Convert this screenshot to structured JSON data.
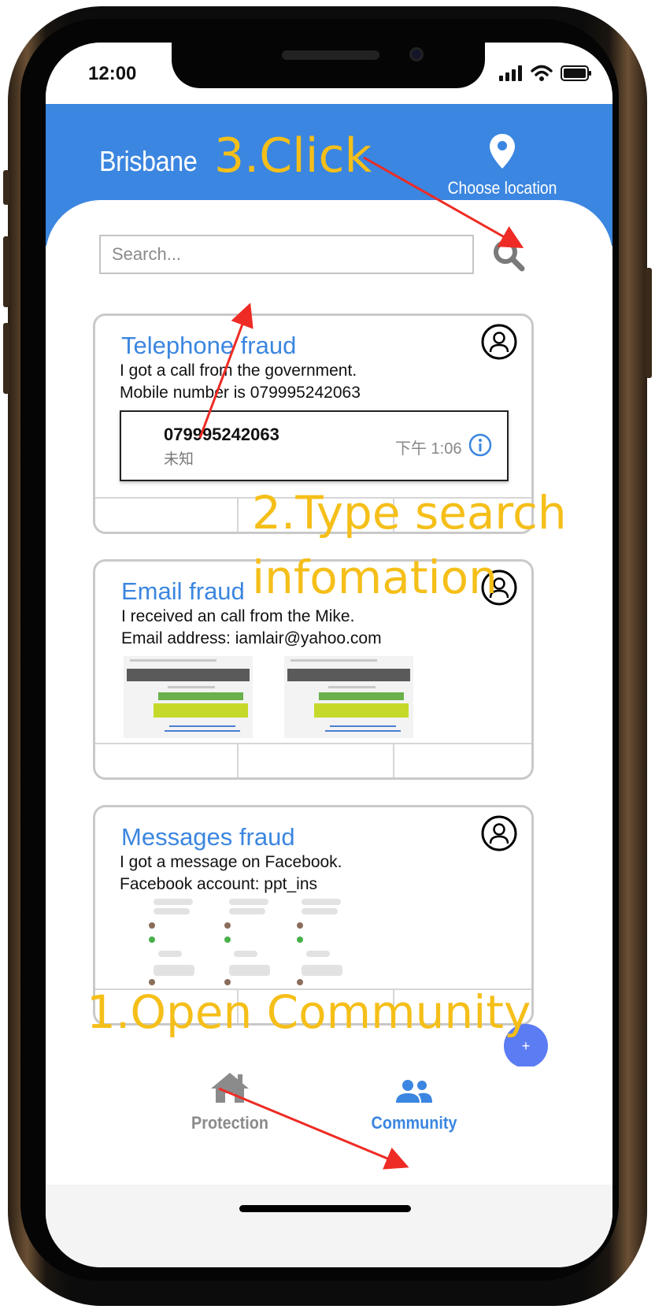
{
  "status_bar": {
    "time": "12:00"
  },
  "header": {
    "city": "Brisbane",
    "location_label": "Choose location"
  },
  "search": {
    "placeholder": "Search..."
  },
  "cards": [
    {
      "title": "Telephone fraud",
      "line1": "I got a call from the government.",
      "line2": "Mobile number is 079995242063",
      "call_log": {
        "number": "079995242063",
        "type": "未知",
        "time": "下午 1:06"
      }
    },
    {
      "title": "Email fraud",
      "line1": "I received an call from the Mike.",
      "line2": "Email address: iamlair@yahoo.com"
    },
    {
      "title": "Messages fraud",
      "line1": "I got a message on Facebook.",
      "line2": "Facebook account:  ppt_ins"
    }
  ],
  "fab": {
    "label": "+"
  },
  "nav": {
    "protection": "Protection",
    "community": "Community"
  },
  "annotations": {
    "step3": "3.Click",
    "step2_line1": "2.Type search",
    "step2_line2": "infomation",
    "step1": "1.Open Community"
  },
  "colors": {
    "accent": "#3b86e0",
    "annotation": "#f5bf19",
    "arrow": "#ee2b24",
    "fab": "#5b7cf2"
  }
}
